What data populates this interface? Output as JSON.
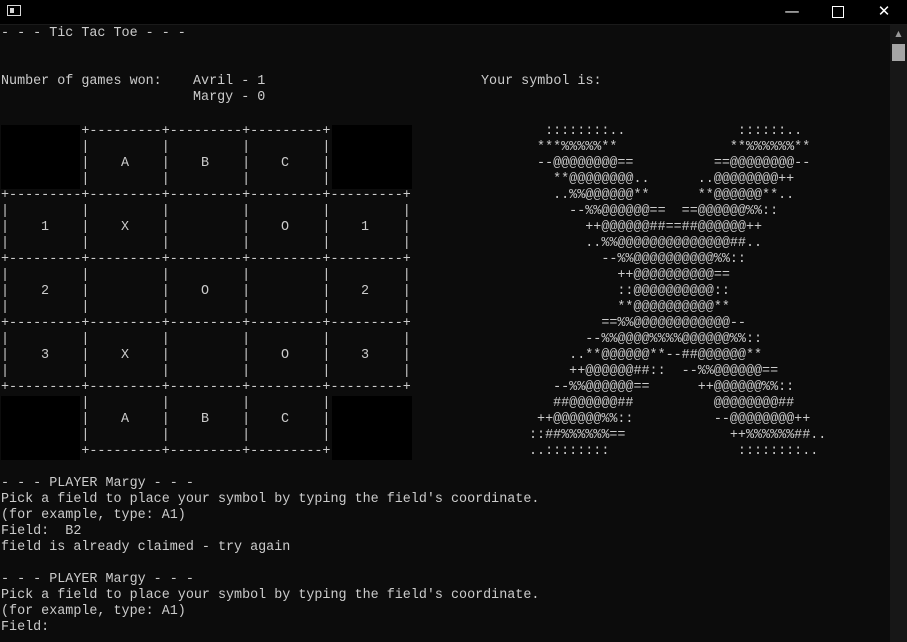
{
  "window": {
    "minimize_glyph": "—",
    "close_glyph": "✕"
  },
  "console": {
    "header": "- - - Tic Tac Toe - - -",
    "games_won_label": "Number of games won:",
    "score_1": "Avril - 1",
    "score_2": "Margy - 0",
    "your_symbol_label": "Your symbol is:",
    "board": {
      "columns": [
        "A",
        "B",
        "C"
      ],
      "rows": [
        {
          "label": "1",
          "cells": [
            "X",
            "",
            "O"
          ]
        },
        {
          "label": "2",
          "cells": [
            "",
            "O",
            ""
          ]
        },
        {
          "label": "3",
          "cells": [
            "X",
            "",
            "O"
          ]
        }
      ]
    },
    "symbol_art": "  ::::::::..              ::::::..\n ***%%%%%**              **%%%%%%**\n --@@@@@@@@==          ==@@@@@@@@--\n   **@@@@@@@@..      ..@@@@@@@@++\n   ..%%@@@@@@**      **@@@@@@**..\n     --%%@@@@@@==  ==@@@@@@%%::\n       ++@@@@@@##==##@@@@@@++\n       ..%%@@@@@@@@@@@@@@##..\n         --%%@@@@@@@@@@%%::\n           ++@@@@@@@@@@==\n           ::@@@@@@@@@@::\n           **@@@@@@@@@@**\n         ==%%@@@@@@@@@@@@--\n       --%%@@@@%%%%@@@@@@%%::\n     ..**@@@@@@**--##@@@@@@**\n     ++@@@@@@##::  --%%@@@@@@==\n   --%%@@@@@@==      ++@@@@@@%%::\n   ##@@@@@@##          @@@@@@@@##\n ++@@@@@@%%::          --@@@@@@@@++\n::##%%%%%%==             ++%%%%%%##..\n..::::::::                ::::::::..",
    "log": [
      "- - - PLAYER Margy - - -",
      "Pick a field to place your symbol by typing the field's coordinate.",
      "(for example, type: A1)",
      "Field:  B2",
      "field is already claimed - try again",
      "",
      "- - - PLAYER Margy - - -",
      "Pick a field to place your symbol by typing the field's coordinate.",
      "(for example, type: A1)",
      "Field:"
    ]
  }
}
